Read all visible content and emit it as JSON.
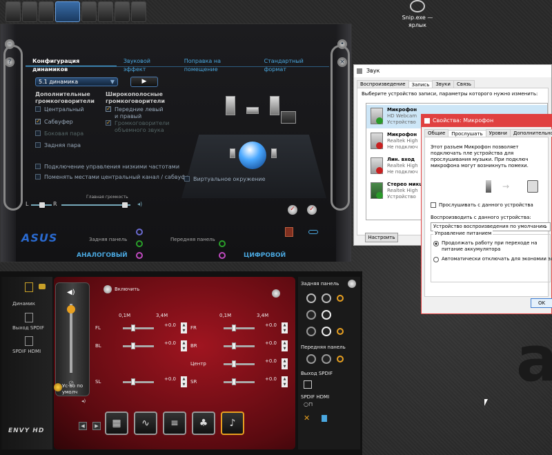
{
  "desktop": {
    "shortcut_name": "Snip.exe —",
    "shortcut_sub": "ярлык"
  },
  "asus": {
    "tabs": [
      {
        "label": "Конфигурация динамиков"
      },
      {
        "label": "Звуковой эффект"
      },
      {
        "label": "Поправка на помещение"
      },
      {
        "label": "Стандартный формат"
      }
    ],
    "speaker_config": "5.1 динамика",
    "groups": {
      "extra": "Дополнительные громкоговорители",
      "fullrange": "Широкополосные громкоговорители"
    },
    "checks_left": [
      {
        "label": "Центральный",
        "checked": false
      },
      {
        "label": "Сабвуфер",
        "checked": true
      },
      {
        "label": "Боковая пара",
        "checked": false
      },
      {
        "label": "Задняя пара",
        "checked": false
      }
    ],
    "checks_right": [
      {
        "label": "Передние левый и правый",
        "checked": true
      },
      {
        "label": "Громкоговорители объемного звука",
        "checked": true
      }
    ],
    "bass_mgmt": "Подключение управления низкими частотами",
    "swap_center": "Поменять местами центральный канал / сабвуфер",
    "virtual_surround": "Виртуальное окружение",
    "main_volume": "Главная громкость",
    "vol_l": "L",
    "vol_r": "R",
    "logo": "ASUS",
    "rear_panel": "Задняя панель",
    "front_panel": "Передняя панель",
    "analog": "АНАЛОГОВЫЙ",
    "digital": "ЦИФРОВОЙ"
  },
  "envy": {
    "sidebar": [
      {
        "label": "Динамик"
      },
      {
        "label": "Выход SPDIF"
      },
      {
        "label": "SPDIF HDMI"
      }
    ],
    "enable": "Включить",
    "freq_low": "0,1M",
    "freq_high": "3,4M",
    "channels_left": [
      {
        "name": "FL",
        "value": "+0.0"
      },
      {
        "name": "BL",
        "value": "+0.0"
      },
      {
        "name": "SL",
        "value": "+0.0"
      }
    ],
    "channels_right": [
      {
        "name": "FR",
        "value": "+0.0"
      },
      {
        "name": "BR",
        "value": "+0.0"
      },
      {
        "name": "Центр",
        "value": "+0.0"
      },
      {
        "name": "SR",
        "value": "+0.0"
      }
    ],
    "default": "Ус-во по умолч",
    "logo": "ENVY HD",
    "right_rear": "Задняя панель",
    "right_front": "Передняя панель",
    "right_spdif": "Выход SPDIF",
    "right_hdmi": "SPDIF HDMI"
  },
  "sound": {
    "title": "Звук",
    "tabs": [
      {
        "label": "Воспроизведение"
      },
      {
        "label": "Запись"
      },
      {
        "label": "Звуки"
      },
      {
        "label": "Связь"
      }
    ],
    "desc": "Выберите устройство записи, параметры которого нужно изменить:",
    "devices": [
      {
        "name": "Микрофон",
        "sub1": "HD Webcam",
        "sub2": "Устройство",
        "badge": "#2a9a2a"
      },
      {
        "name": "Микрофон",
        "sub1": "Realtek High",
        "sub2": "Не подключ",
        "badge": "#c82020"
      },
      {
        "name": "Лин. вход",
        "sub1": "Realtek High",
        "sub2": "Не подключ",
        "badge": "#c82020"
      },
      {
        "name": "Стерео микш",
        "sub1": "Realtek High",
        "sub2": "Устройство",
        "badge": "#2a9a2a"
      }
    ],
    "configure": "Настроить"
  },
  "props": {
    "title": "Свойства: Микрофон",
    "tabs": [
      {
        "label": "Общие"
      },
      {
        "label": "Прослушать"
      },
      {
        "label": "Уровни"
      },
      {
        "label": "Дополнительно"
      }
    ],
    "text": "Этот разъем Микрофон позволяет подключать пле устройства для прослушивания музыки. При подключ микрофона могут возникнуть помехи.",
    "listen": "Прослушивать с данного устройства",
    "playback_label": "Воспроизводить с данного устройства:",
    "playback_value": "Устройство воспроизведения по умолчанию",
    "power_title": "Управление питанием",
    "radio1": "Продолжать работу при переходе на питание аккумулятора",
    "radio2": "Автоматически отключать для экономии элект",
    "ok": "OK"
  }
}
